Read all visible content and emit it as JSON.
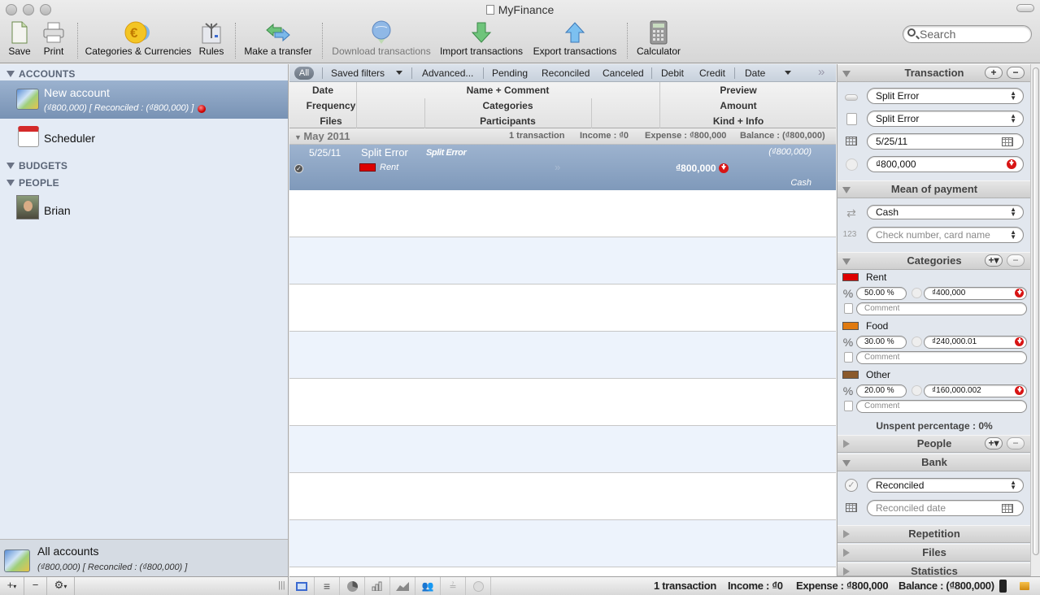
{
  "window": {
    "title": "MyFinance"
  },
  "toolbar": {
    "items": [
      {
        "label": "Save",
        "icon": "save-icon"
      },
      {
        "label": "Print",
        "icon": "print-icon"
      },
      {
        "label": "Categories & Currencies",
        "icon": "euro-icon"
      },
      {
        "label": "Rules",
        "icon": "rules-icon"
      },
      {
        "label": "Make a transfer",
        "icon": "transfer-icon"
      },
      {
        "label": "Download transactions",
        "icon": "download-globe-icon",
        "disabled": true
      },
      {
        "label": "Import transactions",
        "icon": "import-arrow-icon"
      },
      {
        "label": "Export transactions",
        "icon": "export-arrow-icon"
      },
      {
        "label": "Calculator",
        "icon": "calculator-icon"
      }
    ],
    "search_placeholder": "Search"
  },
  "sidebar": {
    "accounts_header": "ACCOUNTS",
    "accounts": [
      {
        "name": "New account",
        "subtitle": "(₫800,000) [ Reconciled : (₫800,000) ]",
        "selected": true
      }
    ],
    "scheduler": "Scheduler",
    "budgets_header": "BUDGETS",
    "people_header": "PEOPLE",
    "people": [
      {
        "name": "Brian"
      }
    ],
    "all_accounts": {
      "name": "All accounts",
      "subtitle": "(₫800,000) [ Reconciled : (₫800,000) ]"
    }
  },
  "filters": {
    "all": "All",
    "saved_filters": "Saved filters",
    "advanced": "Advanced...",
    "pending": "Pending",
    "reconciled": "Reconciled",
    "canceled": "Canceled",
    "debit": "Debit",
    "credit": "Credit",
    "sort": "Date",
    "more": "»"
  },
  "columns": {
    "c1": [
      "Date",
      "Frequency",
      "Files"
    ],
    "c2": [
      "Name + Comment",
      "Categories",
      "Participants"
    ],
    "c3": [
      "Preview",
      "Amount",
      "Kind + Info"
    ]
  },
  "group": {
    "label": "May 2011",
    "count": "1 transaction",
    "income": "Income : ₫0",
    "expense": "Expense : ₫800,000",
    "balance": "Balance : (₫800,000)"
  },
  "transaction": {
    "date": "5/25/11",
    "name": "Split Error",
    "comment": "Split Error",
    "category": "Rent",
    "category_color": "#dd0000",
    "preview": "(₫800,000)",
    "amount": "₫800,000",
    "kind": "Cash",
    "reconciled": true
  },
  "inspector": {
    "transaction_header": "Transaction",
    "name_value": "Split Error",
    "comment_value": "Split Error",
    "date_value": "5/25/11",
    "amount_value": "₫800,000",
    "payment_header": "Mean of payment",
    "payment_value": "Cash",
    "check_placeholder": "Check number, card name",
    "categories_header": "Categories",
    "categories": [
      {
        "name": "Rent",
        "color": "#dd0000",
        "percent": "50.00 %",
        "amount": "₫400,000",
        "comment_placeholder": "Comment"
      },
      {
        "name": "Food",
        "color": "#e07a10",
        "percent": "30.00 %",
        "amount": "₫240,000.01",
        "comment_placeholder": "Comment"
      },
      {
        "name": "Other",
        "color": "#8b5a2b",
        "percent": "20.00 %",
        "amount": "₫160,000.002",
        "comment_placeholder": "Comment"
      }
    ],
    "unspent": "Unspent percentage : 0%",
    "people_header": "People",
    "bank_header": "Bank",
    "bank_status": "Reconciled",
    "reconciled_date_placeholder": "Reconciled date",
    "repetition_header": "Repetition",
    "files_header": "Files",
    "statistics_header": "Statistics"
  },
  "statusbar": {
    "count": "1 transaction",
    "income": "Income : ₫0",
    "expense": "Expense : ₫800,000",
    "balance": "Balance : (₫800,000)"
  },
  "bottom_left": {
    "add": "+",
    "remove": "−",
    "gear": "⚙"
  }
}
